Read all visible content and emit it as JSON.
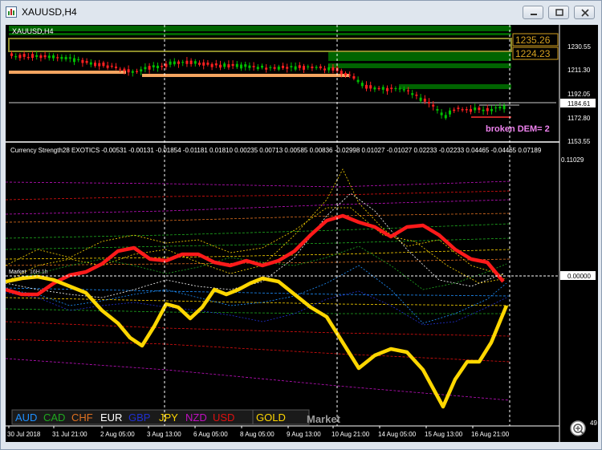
{
  "window": {
    "title": "XAUUSD,H4"
  },
  "main_chart": {
    "symbol_label": "XAUUSD,H4",
    "price_ticks": [
      "1230.55",
      "1211.30",
      "1192.05",
      "1172.80",
      "1153.55"
    ],
    "current_price": "1184.61",
    "price_boxes": [
      "1235.26",
      "1224.23"
    ],
    "broken_label": "broken DEM= 2"
  },
  "indicator": {
    "header": "Currency Strength28 EXOTICS  -0.00531 -0.00131 -0.01854 -0.01181 0.01810 0.00235 0.00713 0.00585 0.00836 -0.02998 0.01027 -0.01027 0.02233 -0.02233 0.04465 -0.04465 0.07189",
    "top_value": "0.11029",
    "zero_value": "0.00000",
    "right_edge_value": "49",
    "market_label_left": "Market",
    "market_label_left_overlap": "16H 1h",
    "market_label_bottom": "Market"
  },
  "legend": {
    "items": [
      {
        "label": "AUD",
        "color": "#1e90ff"
      },
      {
        "label": "CAD",
        "color": "#1faa1f"
      },
      {
        "label": "CHF",
        "color": "#e07020"
      },
      {
        "label": "EUR",
        "color": "#ffffff"
      },
      {
        "label": "GBP",
        "color": "#2030d0"
      },
      {
        "label": "JPY",
        "color": "#ffd700"
      },
      {
        "label": "NZD",
        "color": "#c010c0"
      },
      {
        "label": "USD",
        "color": "#e01010"
      },
      {
        "label": "GOLD",
        "color": "#ffd700"
      }
    ]
  },
  "time_axis": {
    "labels": [
      "30 Jul 2018",
      "31 Jul 21:00",
      "2 Aug 05:00",
      "3 Aug 13:00",
      "6 Aug 05:00",
      "8 Aug 05:00",
      "9 Aug 13:00",
      "10 Aug 21:00",
      "14 Aug 05:00",
      "15 Aug 13:00",
      "16 Aug 21:00"
    ]
  },
  "colors": {
    "background": "#000000",
    "grid": "#ffffff",
    "bull_candle": "#00c000",
    "bear_candle": "#ff2020",
    "zone_green": "#006400",
    "zone_orange": "#f4a460",
    "usd_line": "#ff1a1a",
    "gold_line": "#ffd700"
  }
}
